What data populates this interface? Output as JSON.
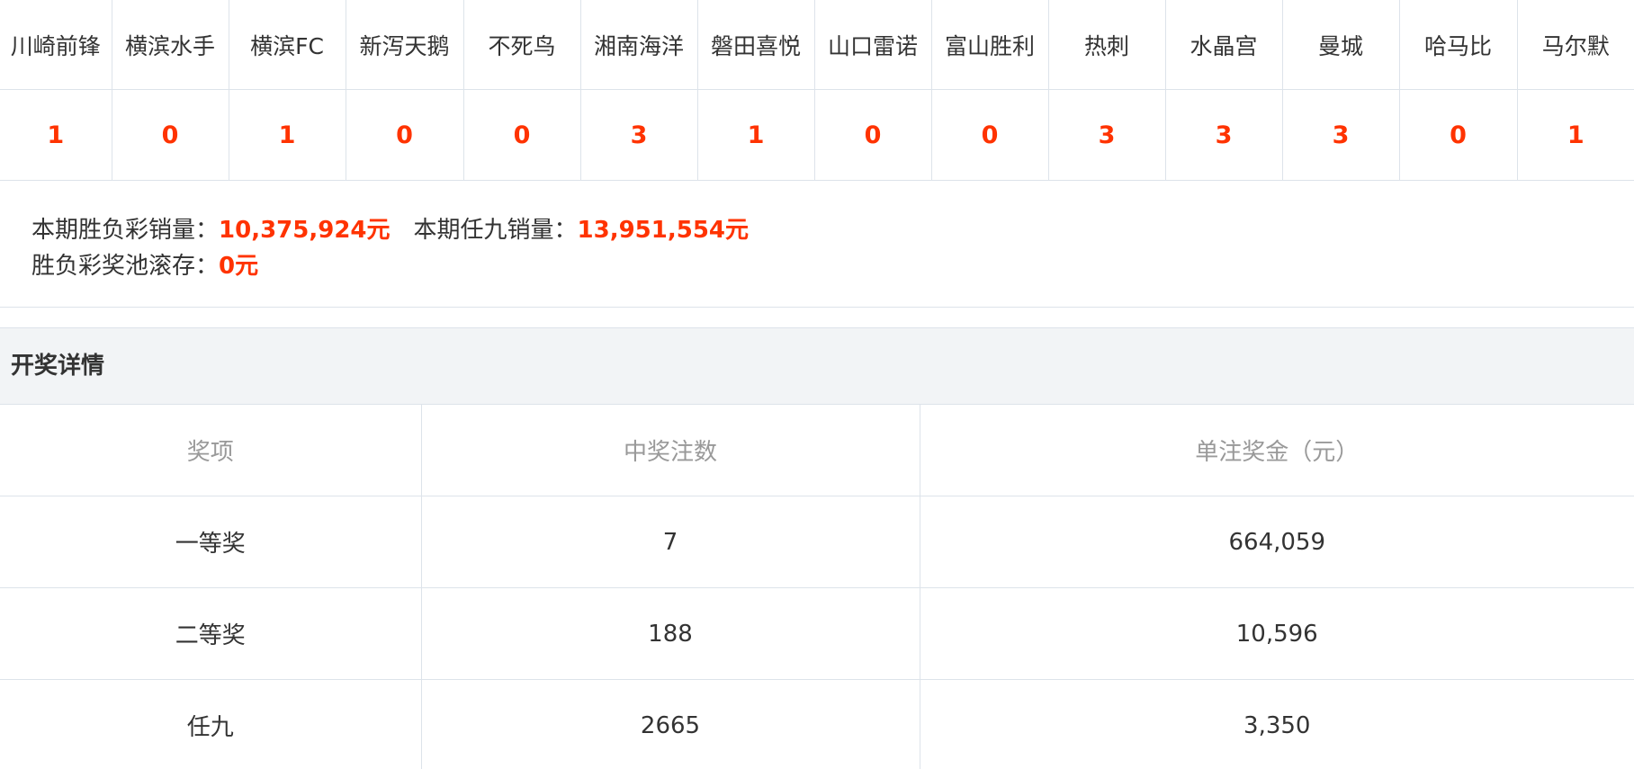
{
  "matches": {
    "teams": [
      "川崎前锋",
      "横滨水手",
      "横滨FC",
      "新泻天鹅",
      "不死鸟",
      "湘南海洋",
      "磐田喜悦",
      "山口雷诺",
      "富山胜利",
      "热刺",
      "水晶宫",
      "曼城",
      "哈马比",
      "马尔默"
    ],
    "results": [
      "1",
      "0",
      "1",
      "0",
      "0",
      "3",
      "1",
      "0",
      "0",
      "3",
      "3",
      "3",
      "0",
      "1"
    ]
  },
  "sales": {
    "sfc_label": "本期胜负彩销量：",
    "sfc_value": "10,375,924元",
    "r9_label": "本期任九销量：",
    "r9_value": "13,951,554元",
    "pool_label": "胜负彩奖池滚存：",
    "pool_value": "0元"
  },
  "details": {
    "title": "开奖详情",
    "headers": [
      "奖项",
      "中奖注数",
      "单注奖金（元）"
    ],
    "rows": [
      {
        "prize": "一等奖",
        "count": "7",
        "amount": "664,059"
      },
      {
        "prize": "二等奖",
        "count": "188",
        "amount": "10,596"
      },
      {
        "prize": "任九",
        "count": "2665",
        "amount": "3,350"
      }
    ]
  },
  "colors": {
    "accent": "#ff3300",
    "border": "#dde3ea",
    "header_bg": "#f2f4f6"
  }
}
